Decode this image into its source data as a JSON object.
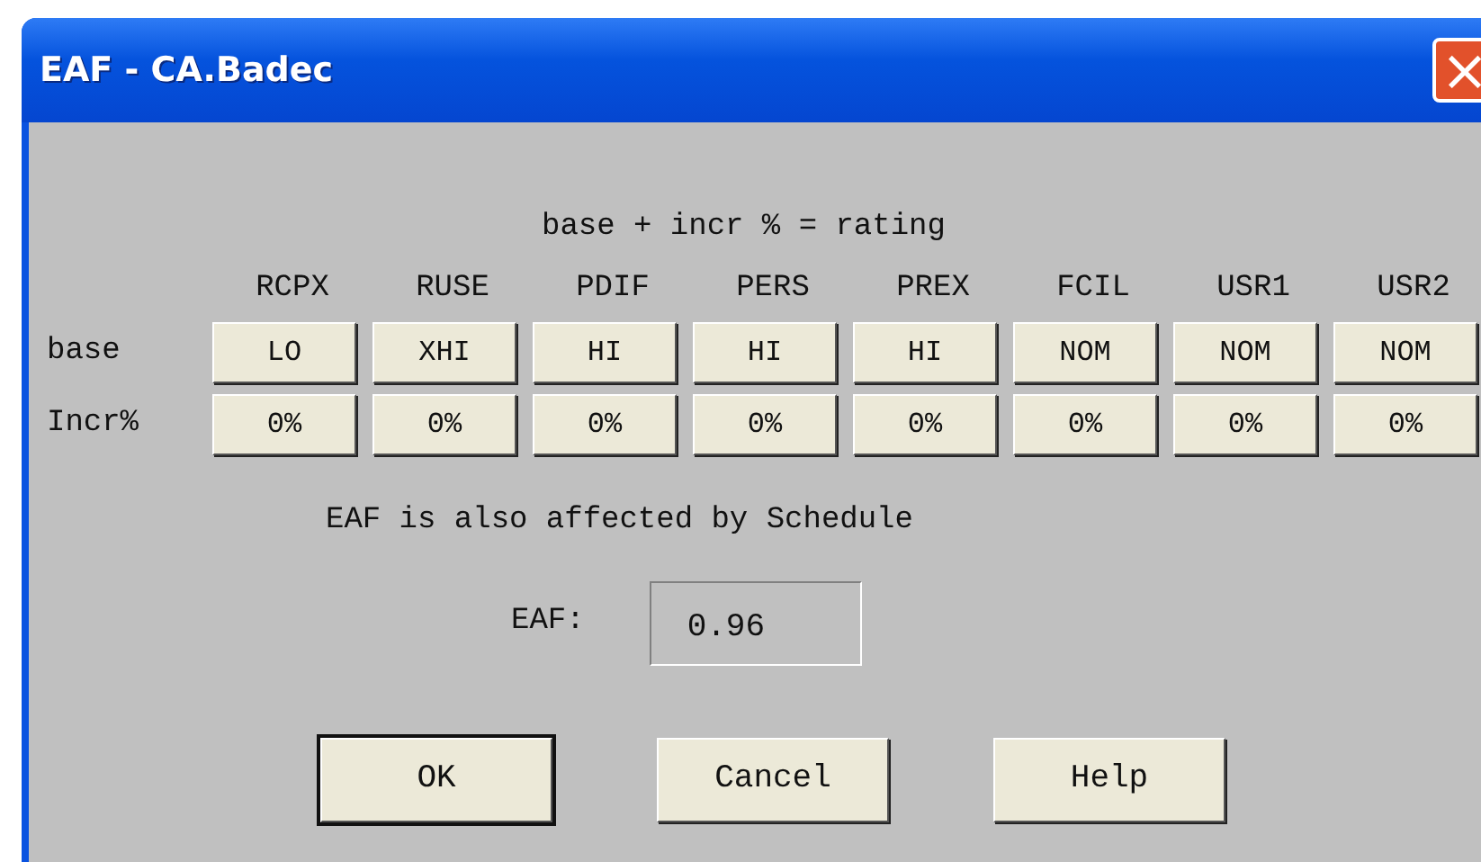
{
  "window": {
    "title": "EAF - CA.Badec",
    "close_button": "×"
  },
  "heading": "base + incr % = rating",
  "columns": [
    "RCPX",
    "RUSE",
    "PDIF",
    "PERS",
    "PREX",
    "FCIL",
    "USR1",
    "USR2"
  ],
  "rows": [
    {
      "label": "base",
      "values": [
        "LO",
        "XHI",
        "HI",
        "HI",
        "HI",
        "NOM",
        "NOM",
        "NOM"
      ]
    },
    {
      "label": "Incr%",
      "values": [
        "0%",
        "0%",
        "0%",
        "0%",
        "0%",
        "0%",
        "0%",
        "0%"
      ]
    }
  ],
  "note": "EAF is also affected by Schedule",
  "result": {
    "label": "EAF:",
    "value": "0.96"
  },
  "buttons": [
    {
      "label": "OK",
      "default": true
    },
    {
      "label": "Cancel",
      "default": false
    },
    {
      "label": "Help",
      "default": false
    }
  ]
}
